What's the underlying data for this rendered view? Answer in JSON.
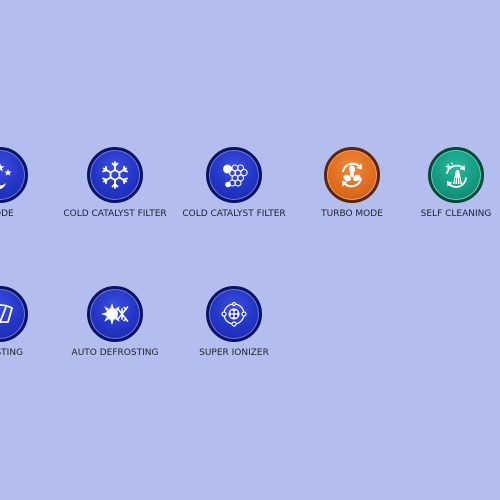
{
  "background_color": "#b4beee",
  "features": [
    {
      "id": "night-mode",
      "label": "MODE",
      "color": "blue",
      "icon": "moon-stars-icon"
    },
    {
      "id": "cold-catalyst-filter-1",
      "label": "COLD CATALYST FILTER",
      "color": "blue",
      "icon": "snowflake-icon"
    },
    {
      "id": "cold-catalyst-filter-2",
      "label": "COLD CATALYST FILTER",
      "color": "blue",
      "icon": "molecule-cluster-icon"
    },
    {
      "id": "turbo-mode",
      "label": "TURBO MODE",
      "color": "orange",
      "icon": "fan-rotate-icon"
    },
    {
      "id": "self-cleaning",
      "label": "SELF CLEANING",
      "color": "teal",
      "icon": "brush-rotate-icon"
    },
    {
      "id": "defrosting",
      "label": "FROSTING",
      "color": "blue",
      "icon": "windshield-defrost-icon"
    },
    {
      "id": "auto-defrosting",
      "label": "AUTO DEFROSTING",
      "color": "blue",
      "icon": "sun-snow-icon"
    },
    {
      "id": "super-ionizer",
      "label": "SUPER IONIZER",
      "color": "blue",
      "icon": "ionizer-icon"
    }
  ],
  "colors": {
    "blue": "#2234c4",
    "orange": "#e06d1e",
    "teal": "#159a80",
    "label_text": "#1e2030"
  }
}
